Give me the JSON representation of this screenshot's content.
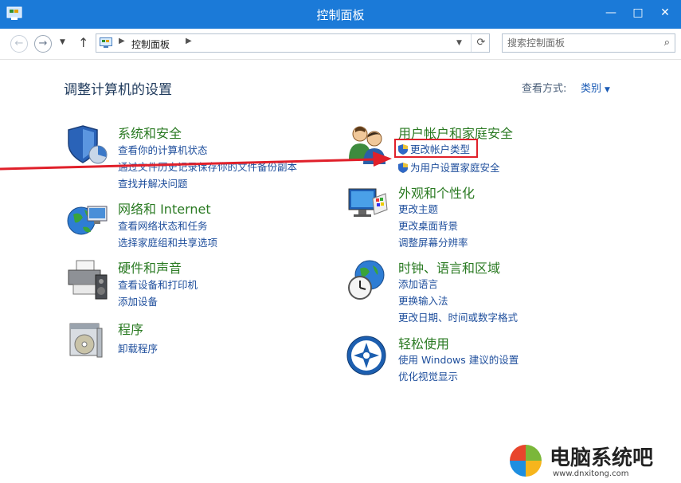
{
  "window": {
    "title": "控制面板",
    "buttons": {
      "minimize": "—",
      "maximize": "□",
      "close": "✕"
    }
  },
  "navigation": {
    "breadcrumb": "控制面板",
    "search_placeholder": "搜索控制面板"
  },
  "main": {
    "heading": "调整计算机的设置",
    "view_by_label": "查看方式:",
    "view_by_value": "类别"
  },
  "categories": [
    {
      "title": "系统和安全",
      "icon": "shield-icon",
      "links": [
        "查看你的计算机状态",
        "通过文件历史记录保存你的文件备份副本",
        "查找并解决问题"
      ]
    },
    {
      "title": "网络和 Internet",
      "icon": "network-globe-icon",
      "links": [
        "查看网络状态和任务",
        "选择家庭组和共享选项"
      ]
    },
    {
      "title": "硬件和声音",
      "icon": "printer-icon",
      "links": [
        "查看设备和打印机",
        "添加设备"
      ]
    },
    {
      "title": "程序",
      "icon": "programs-icon",
      "links": [
        "卸载程序"
      ]
    },
    {
      "title": "用户帐户和家庭安全",
      "icon": "users-icon",
      "links": [
        "更改帐户类型",
        "为用户设置家庭安全"
      ]
    },
    {
      "title": "外观和个性化",
      "icon": "appearance-monitor-icon",
      "links": [
        "更改主题",
        "更改桌面背景",
        "调整屏幕分辨率"
      ]
    },
    {
      "title": "时钟、语言和区域",
      "icon": "clock-globe-icon",
      "links": [
        "添加语言",
        "更换输入法",
        "更改日期、时间或数字格式"
      ]
    },
    {
      "title": "轻松使用",
      "icon": "ease-of-access-icon",
      "links": [
        "使用 Windows 建议的设置",
        "优化视觉显示"
      ]
    }
  ],
  "watermark": {
    "brand": "电脑系统吧",
    "url": "www.dnxitong.com"
  },
  "colors": {
    "titlebar": "#1b7ad8",
    "category_title": "#2a7a22",
    "link": "#1e4e9c",
    "highlight": "#e0202a"
  }
}
